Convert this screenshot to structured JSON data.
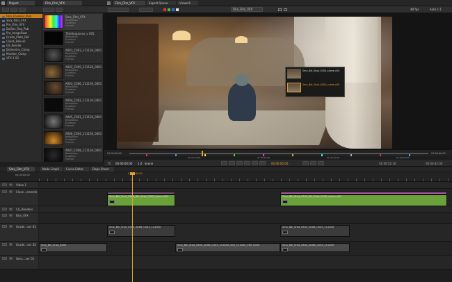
{
  "window": {
    "project_tab": "Project",
    "film_tab": "Film_Film_VFX",
    "film_tab_2": "Film_Film_VFX",
    "export_tab": "Export Queue",
    "viewer_tab": "Viewer1",
    "playback_dropdown": "Film_Film_VFX",
    "right_status": "48 fps",
    "right_status_2": "Auto 1:1"
  },
  "project_panel": {
    "tree": [
      "Film_Forensic_Pub",
      "Smx_Film_VFX",
      "Pre_Film_VFX",
      "Dailies_Seq_Pub",
      "Pre_ImageRoot",
      "Grade_Plate_Ref",
      "Client_Deliver",
      "QS_Render",
      "Deliveries_Comp",
      "Monitor_Comp",
      "VFX 1 03"
    ],
    "header_button": "Icons"
  },
  "bin": {
    "items": [
      {
        "title": "Smx_Film_VFX",
        "meta": [
          "Resolution",
          "Duration",
          "Format"
        ]
      },
      {
        "title": "TitleSequence_v 001",
        "meta": [
          "Resolution",
          "Duration",
          "Format"
        ]
      },
      {
        "title": "A001_C003_111130_0001.v",
        "meta": [
          "Resolution",
          "Duration",
          "Format"
        ]
      },
      {
        "title": "A002_C005_111130_0001.v",
        "meta": [
          "Resolution",
          "Duration",
          "Format"
        ]
      },
      {
        "title": "A003_C006_111130_0001.v",
        "meta": [
          "Resolution",
          "Duration",
          "Format"
        ]
      },
      {
        "title": "A004_C002_111130_0001.v",
        "meta": [
          "Resolution",
          "Duration",
          "Format"
        ]
      },
      {
        "title": "A005_C001_111130_0001.v",
        "meta": [
          "Resolution",
          "Duration",
          "Format"
        ]
      },
      {
        "title": "A006_C004_111130_0001.v",
        "meta": [
          "Resolution",
          "Duration",
          "Format"
        ]
      },
      {
        "title": "A007_C008_111130_0001.v",
        "meta": [
          "Resolution",
          "Duration",
          "Format"
        ]
      }
    ]
  },
  "viewer": {
    "popup_title_1": "Smx_Blk_Shot_0300_scene.v00",
    "popup_title_2": "Smx_Blk_Shot_0300_scene.v00",
    "scrubber_start": "01:00:00:00",
    "scrubber_end": "01:00:40:00",
    "timecode": "00:00:00:00",
    "tc_label": "TC",
    "rate": "1.0",
    "mode": "Scene",
    "in_out": "00:00:00:00",
    "right_timecode": "01:00:52:10",
    "far_right_timecode": "00:00:42:00",
    "ruler_labels": [
      "01:00:10:00",
      "01:00:20:00",
      "01:00:30:00",
      "01:00:40:00"
    ]
  },
  "timeline": {
    "sequence_tab": "Smx_Film_VFX",
    "node_graph_tab": "Node Graph",
    "curve_editor_tab": "Curve Editor",
    "dope_sheet_tab": "Dope Sheet",
    "playhead_tc": "01:00:00:00",
    "ruler_start": "01:00:00:00",
    "tracks": [
      {
        "name": "Video 1"
      },
      {
        "name": "Clean...ements"
      },
      {
        "name": "CG_Renders"
      },
      {
        "name": "Film_VFX"
      },
      {
        "name": "Grade...ver 01"
      },
      {
        "name": "Grade...ver 02"
      },
      {
        "name": "Sens...ver 01"
      }
    ],
    "clips": {
      "clean_a": "Smx_Blk_Shot_0300_Blk_Shot_0300_scene.v00",
      "clean_b": "Smx_Blk_Shot_0300_Blk_Shot_0300_scene.v00",
      "film_a": "Smx_Blk_Shot_0300_A00B_C003_111000",
      "film_b": "Smx_Blk_Shot_0300_A00B_C003_111000",
      "grade_a": "Smx_Blk_Shot_0300",
      "grade_b": "Smx_Blk_Shot_0300_A00B_C003_111000_V00_111000_V00_0000",
      "grade_c": "Smx_Blk_Shot_0300_A00B_C003_111000"
    }
  },
  "colors": {
    "accent_orange": "#f0a020",
    "clip_green": "#6aa13a",
    "clip_pink": "#b05aa8",
    "playhead": "#e0a030"
  }
}
